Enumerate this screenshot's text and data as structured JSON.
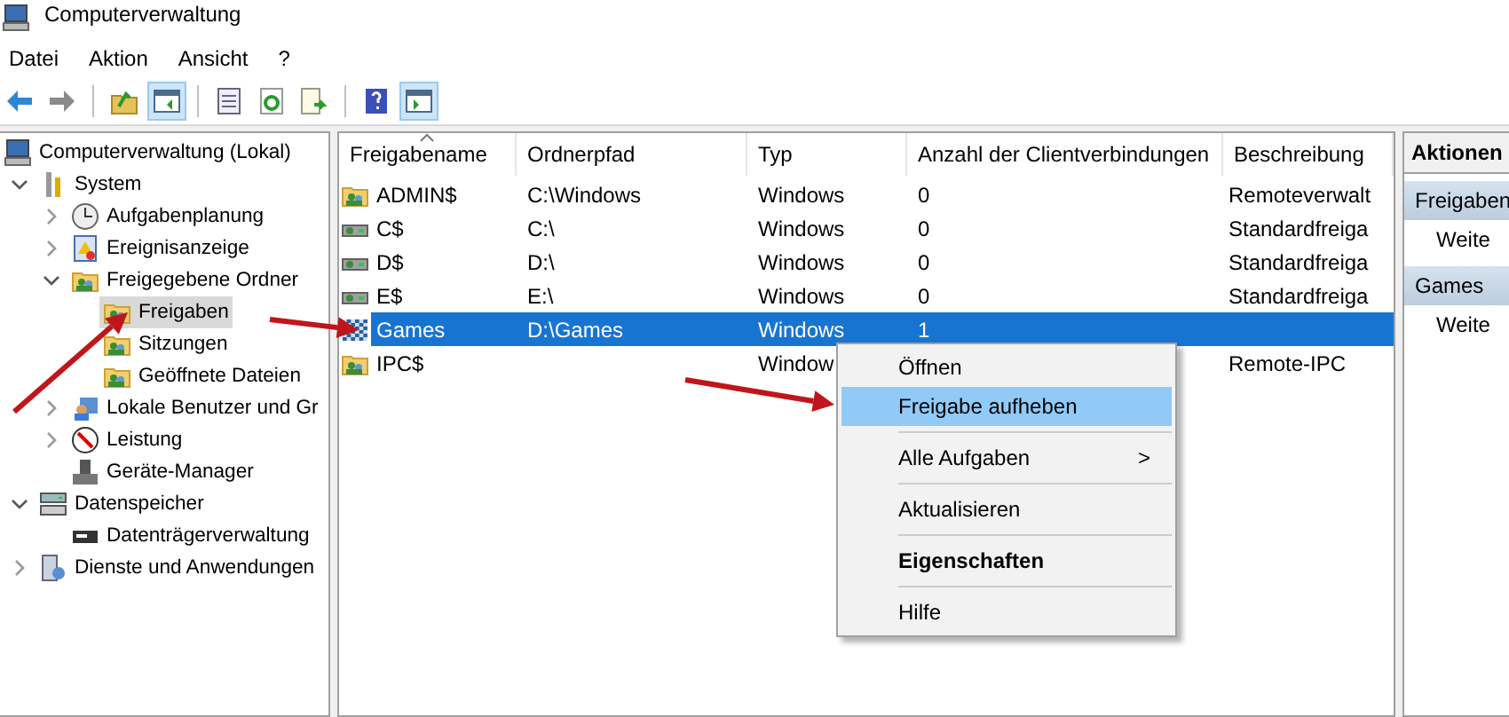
{
  "window": {
    "title": "Computerverwaltung"
  },
  "menu": [
    "Datei",
    "Aktion",
    "Ansicht",
    "?"
  ],
  "toolbar": [
    {
      "kind": "back",
      "pressed": false
    },
    {
      "kind": "forward",
      "pressed": false
    },
    {
      "kind": "sep"
    },
    {
      "kind": "up",
      "pressed": false
    },
    {
      "kind": "tree",
      "pressed": true
    },
    {
      "kind": "sep"
    },
    {
      "kind": "props",
      "pressed": false
    },
    {
      "kind": "refresh",
      "pressed": false
    },
    {
      "kind": "export",
      "pressed": false
    },
    {
      "kind": "sep"
    },
    {
      "kind": "help",
      "pressed": false
    },
    {
      "kind": "pane",
      "pressed": true
    }
  ],
  "tree": [
    {
      "label": "Computerverwaltung (Lokal)",
      "selected": false,
      "children": [
        {
          "label": "System",
          "expanded": true,
          "selected": false,
          "children": [
            {
              "label": "Aufgabenplanung",
              "expanded": false,
              "selected": false
            },
            {
              "label": "Ereignisanzeige",
              "expanded": false,
              "selected": false
            },
            {
              "label": "Freigegebene Ordner",
              "expanded": true,
              "selected": false,
              "children": [
                {
                  "label": "Freigaben",
                  "selected": true
                },
                {
                  "label": "Sitzungen",
                  "selected": false
                },
                {
                  "label": "Geöffnete Dateien",
                  "selected": false
                }
              ]
            },
            {
              "label": "Lokale Benutzer und Gr",
              "expanded": false,
              "selected": false
            },
            {
              "label": "Leistung",
              "expanded": false,
              "selected": false
            },
            {
              "label": "Geräte-Manager",
              "selected": false
            }
          ]
        },
        {
          "label": "Datenspeicher",
          "expanded": true,
          "selected": false,
          "children": [
            {
              "label": "Datenträgerverwaltung",
              "selected": false
            }
          ]
        },
        {
          "label": "Dienste und Anwendungen",
          "expanded": false,
          "selected": false
        }
      ]
    }
  ],
  "table": {
    "columns": [
      {
        "label": "Freigabename",
        "sorted": true
      },
      {
        "label": "Ordnerpfad",
        "sorted": false
      },
      {
        "label": "Typ",
        "sorted": false
      },
      {
        "label": "Anzahl der Clientverbindungen",
        "sorted": false
      },
      {
        "label": "Beschreibung",
        "sorted": false
      }
    ],
    "rows": [
      {
        "kind": "folder",
        "cells": [
          "ADMIN$",
          "C:\\Windows",
          "Windows",
          "0",
          "Remoteverwalt"
        ],
        "selected": false
      },
      {
        "kind": "drive",
        "cells": [
          "C$",
          "C:\\",
          "Windows",
          "0",
          "Standardfreiga"
        ],
        "selected": false
      },
      {
        "kind": "drive",
        "cells": [
          "D$",
          "D:\\",
          "Windows",
          "0",
          "Standardfreiga"
        ],
        "selected": false
      },
      {
        "kind": "drive",
        "cells": [
          "E$",
          "E:\\",
          "Windows",
          "0",
          "Standardfreiga"
        ],
        "selected": false
      },
      {
        "kind": "checker",
        "cells": [
          "Games",
          "D:\\Games",
          "Windows",
          "1",
          ""
        ],
        "selected": true
      },
      {
        "kind": "folder",
        "cells": [
          "IPC$",
          "",
          "Window",
          "",
          "Remote-IPC"
        ],
        "selected": false
      }
    ]
  },
  "actions": {
    "title": "Aktionen",
    "sections": [
      {
        "title": "Freigaben",
        "items": [
          "Weite"
        ]
      },
      {
        "title": "Games",
        "items": [
          "Weite"
        ]
      }
    ]
  },
  "context_menu": [
    {
      "kind": "item",
      "label": "Öffnen",
      "selected": false
    },
    {
      "kind": "item",
      "label": "Freigabe aufheben",
      "selected": true
    },
    {
      "kind": "sep"
    },
    {
      "kind": "submenu",
      "label": "Alle Aufgaben",
      "selected": false
    },
    {
      "kind": "sep"
    },
    {
      "kind": "item",
      "label": "Aktualisieren",
      "selected": false
    },
    {
      "kind": "sep"
    },
    {
      "kind": "default",
      "label": "Eigenschaften",
      "selected": false
    },
    {
      "kind": "sep"
    },
    {
      "kind": "item",
      "label": "Hilfe",
      "selected": false
    }
  ],
  "submenu_mark": ">"
}
